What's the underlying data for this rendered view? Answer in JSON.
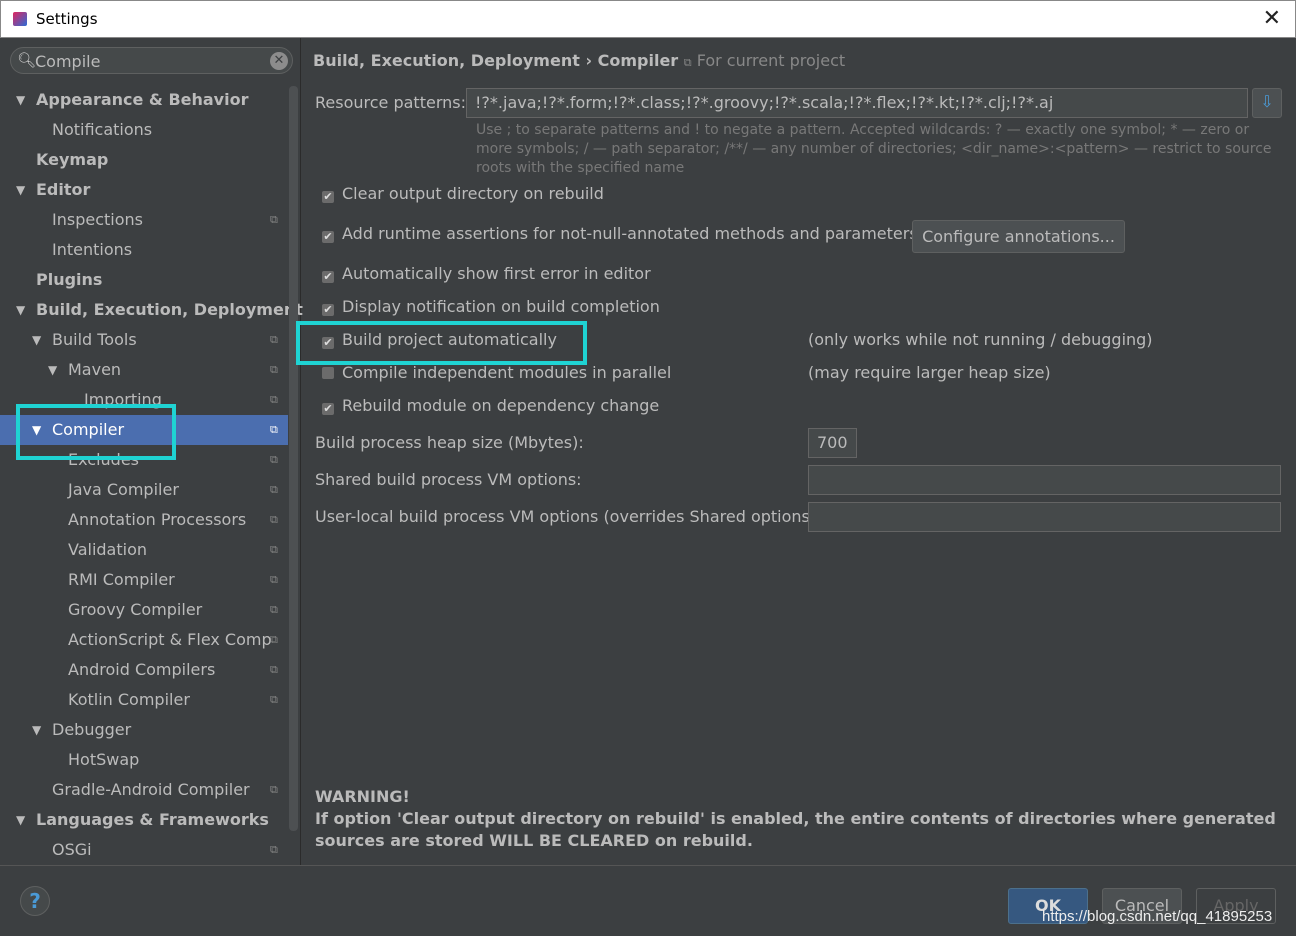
{
  "window": {
    "title": "Settings"
  },
  "search": {
    "value": "Compile"
  },
  "tree": [
    {
      "label": "Appearance & Behavior",
      "level": 0,
      "arrow": true,
      "bold": true,
      "copy": false
    },
    {
      "label": "Notifications",
      "level": 1,
      "arrow": false,
      "bold": false,
      "copy": false
    },
    {
      "label": "Keymap",
      "level": 0,
      "arrow": false,
      "bold": true,
      "copy": false
    },
    {
      "label": "Editor",
      "level": 0,
      "arrow": true,
      "bold": true,
      "copy": false
    },
    {
      "label": "Inspections",
      "level": 1,
      "arrow": false,
      "bold": false,
      "copy": true
    },
    {
      "label": "Intentions",
      "level": 1,
      "arrow": false,
      "bold": false,
      "copy": false
    },
    {
      "label": "Plugins",
      "level": 0,
      "arrow": false,
      "bold": true,
      "copy": false
    },
    {
      "label": "Build, Execution, Deployment",
      "level": 0,
      "arrow": true,
      "bold": true,
      "copy": false
    },
    {
      "label": "Build Tools",
      "level": 1,
      "arrow": true,
      "bold": false,
      "copy": true
    },
    {
      "label": "Maven",
      "level": 2,
      "arrow": true,
      "bold": false,
      "copy": true
    },
    {
      "label": "Importing",
      "level": 3,
      "arrow": false,
      "bold": false,
      "copy": true
    },
    {
      "label": "Compiler",
      "level": 1,
      "arrow": true,
      "bold": false,
      "copy": true,
      "selected": true
    },
    {
      "label": "Excludes",
      "level": 2,
      "arrow": false,
      "bold": false,
      "copy": true
    },
    {
      "label": "Java Compiler",
      "level": 2,
      "arrow": false,
      "bold": false,
      "copy": true
    },
    {
      "label": "Annotation Processors",
      "level": 2,
      "arrow": false,
      "bold": false,
      "copy": true
    },
    {
      "label": "Validation",
      "level": 2,
      "arrow": false,
      "bold": false,
      "copy": true
    },
    {
      "label": "RMI Compiler",
      "level": 2,
      "arrow": false,
      "bold": false,
      "copy": true
    },
    {
      "label": "Groovy Compiler",
      "level": 2,
      "arrow": false,
      "bold": false,
      "copy": true
    },
    {
      "label": "ActionScript & Flex Comp",
      "level": 2,
      "arrow": false,
      "bold": false,
      "copy": true
    },
    {
      "label": "Android Compilers",
      "level": 2,
      "arrow": false,
      "bold": false,
      "copy": true
    },
    {
      "label": "Kotlin Compiler",
      "level": 2,
      "arrow": false,
      "bold": false,
      "copy": true
    },
    {
      "label": "Debugger",
      "level": 1,
      "arrow": true,
      "bold": false,
      "copy": false
    },
    {
      "label": "HotSwap",
      "level": 2,
      "arrow": false,
      "bold": false,
      "copy": false
    },
    {
      "label": "Gradle-Android Compiler",
      "level": 1,
      "arrow": false,
      "bold": false,
      "copy": true
    },
    {
      "label": "Languages & Frameworks",
      "level": 0,
      "arrow": true,
      "bold": true,
      "copy": false
    },
    {
      "label": "OSGi",
      "level": 1,
      "arrow": false,
      "bold": false,
      "copy": true
    }
  ],
  "breadcrumb": {
    "parent": "Build, Execution, Deployment",
    "sep": "›",
    "current": "Compiler",
    "scope": "For current project"
  },
  "resource": {
    "label": "Resource patterns:",
    "value": "!?*.java;!?*.form;!?*.class;!?*.groovy;!?*.scala;!?*.flex;!?*.kt;!?*.clj;!?*.aj",
    "hint": "Use ; to separate patterns and ! to negate a pattern. Accepted wildcards: ? — exactly one symbol; * — zero or more symbols; / — path separator; /**/ — any number of directories; <dir_name>:<pattern> — restrict to source roots with the specified name"
  },
  "options": [
    {
      "label": "Clear output directory on rebuild",
      "checked": true
    },
    {
      "label": "Add runtime assertions for not-null-annotated methods and parameters",
      "checked": true
    },
    {
      "label": "Automatically show first error in editor",
      "checked": true
    },
    {
      "label": "Display notification on build completion",
      "checked": true
    },
    {
      "label": "Build project automatically",
      "checked": true,
      "note": "(only works while not running / debugging)"
    },
    {
      "label": "Compile independent modules in parallel",
      "checked": false,
      "note": "(may require larger heap size)"
    },
    {
      "label": "Rebuild module on dependency change",
      "checked": true
    }
  ],
  "configure_button": "Configure annotations...",
  "heap": {
    "label": "Build process heap size (Mbytes):",
    "value": "700"
  },
  "shared_vm": {
    "label": "Shared build process VM options:",
    "value": ""
  },
  "user_vm": {
    "label": "User-local build process VM options (overrides Shared options):",
    "value": ""
  },
  "warning": {
    "title": "WARNING!",
    "text": "If option 'Clear output directory on rebuild' is enabled, the entire contents of directories where generated sources are stored WILL BE CLEARED on rebuild."
  },
  "footer": {
    "help": "?",
    "ok": "OK",
    "cancel": "Cancel",
    "apply": "Apply",
    "watermark": "https://blog.csdn.net/qq_41895253"
  },
  "colors": {
    "background": "#3c3f41",
    "selection": "#4b6eaf",
    "highlight": "#1fd3d3"
  }
}
